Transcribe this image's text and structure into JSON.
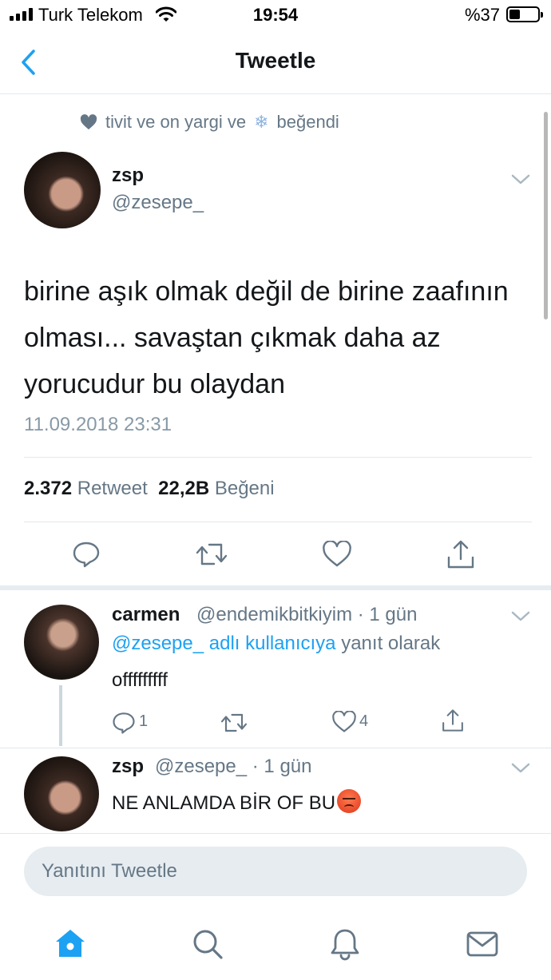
{
  "status_bar": {
    "carrier": "Turk Telekom",
    "time": "19:54",
    "battery_percent": "%37",
    "battery_level": 0.37
  },
  "nav": {
    "title": "Tweetle"
  },
  "liked_by": {
    "text_before": "tivit ve on yargi ve",
    "text_after": "beğendi"
  },
  "tweet": {
    "author_name": "zsp",
    "author_handle": "@zesepe_",
    "text": "birine aşık olmak değil de birine zaafının olması... savaştan çıkmak daha az yorucudur bu olaydan",
    "timestamp": "11.09.2018 23:31",
    "retweet_count": "2.372",
    "retweet_label": "Retweet",
    "like_count": "22,2B",
    "like_label": "Beğeni"
  },
  "replies": [
    {
      "name": "carmen",
      "meta": "@endemikbitkiyim · 1 gün",
      "reply_mention": "@zesepe_ adlı kullanıcıya",
      "reply_suffix": "yanıt olarak",
      "text": "offfffffff",
      "reply_count": "1",
      "like_count": "4"
    },
    {
      "name": "zsp",
      "meta": "@zesepe_ · 1 gün",
      "text": "NE ANLAMDA BİR OF BU"
    }
  ],
  "compose": {
    "placeholder": "Yanıtını Tweetle"
  },
  "colors": {
    "accent": "#1da1f2",
    "text_primary": "#14171a",
    "text_secondary": "#657786",
    "divider": "#e1e8ed"
  },
  "icons": {
    "liked_by": "heart-icon",
    "reply": "reply-icon",
    "retweet": "retweet-icon",
    "like": "heart-outline-icon",
    "share": "share-icon",
    "tab_home": "home-icon",
    "tab_search": "search-icon",
    "tab_notifications": "bell-icon",
    "tab_messages": "mail-icon"
  }
}
